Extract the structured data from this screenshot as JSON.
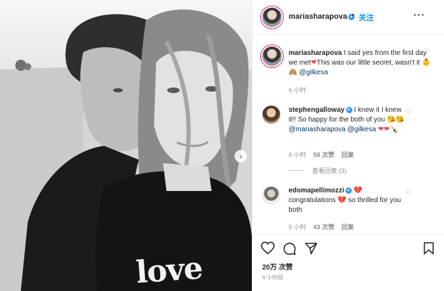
{
  "header": {
    "username": "mariasharapova",
    "verified": "✔",
    "follow_label": "关注",
    "separator": "•",
    "more_label": "···"
  },
  "caption": {
    "username": "mariasharapova",
    "text_a": "I said yes from the first day we met",
    "heart": "❤",
    "text_b": "This was our little secret, wasn't it",
    "emoji": "👶🙈",
    "mention": "@gilkesa",
    "time": "6 小时"
  },
  "comments": [
    {
      "username": "stephengalloway",
      "verified": "✔",
      "text": "I knew it I knew it!! So happy for the both of you",
      "emoji": "😘😘",
      "mention1": "@mariasharapova",
      "mention2": "@gilkesa",
      "tail_emoji": "❤❤🍾",
      "time": "6 小时",
      "likes": "58 次赞",
      "reply": "回复",
      "view_replies": "查看回复 (3)"
    },
    {
      "username": "edomapellimozzi",
      "verified": "✔",
      "pre_emoji": "💔",
      "text_a": "congratulations",
      "heart": "💔",
      "text_b": "so thrilled for you both",
      "time": "5 小时",
      "likes": "43 次赞",
      "reply": "回复"
    }
  ],
  "footer": {
    "likes": "20万 次赞",
    "timestamp": "6 小时前"
  },
  "photo": {
    "shirt_text": "love",
    "next_arrow": "›"
  },
  "colors": {
    "link": "#00376b",
    "follow": "#0095f6",
    "verified": "#3897f0",
    "meta": "#8e8e8e",
    "heart": "#ed4956"
  },
  "icons": [
    "heart-icon",
    "comment-icon",
    "share-icon",
    "bookmark-icon",
    "more-icon",
    "verified-icon",
    "next-arrow-icon",
    "like-comment-icon"
  ]
}
